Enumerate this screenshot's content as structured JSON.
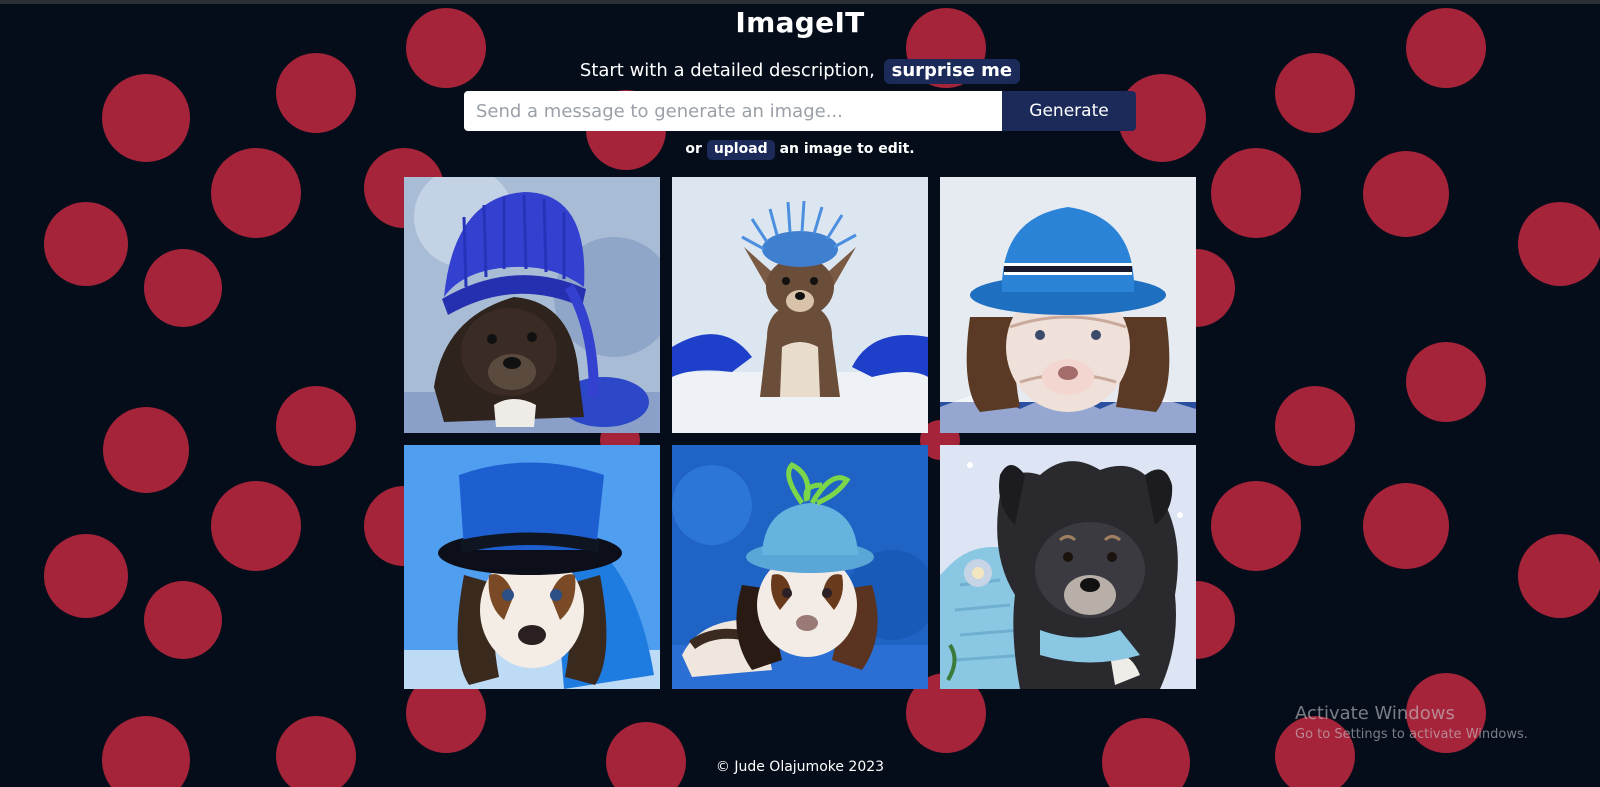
{
  "app": {
    "title": "ImageIT"
  },
  "hero": {
    "subtitle": "Start with a detailed description,",
    "surprise_label": "surprise me"
  },
  "prompt": {
    "placeholder": "Send a message to generate an image...",
    "value": "",
    "generate_label": "Generate"
  },
  "upload_line": {
    "prefix": "or",
    "upload_label": "upload",
    "suffix": "an image to edit."
  },
  "gallery": {
    "images": [
      {
        "subject": "boxer-puppy-knit-blue-hat"
      },
      {
        "subject": "chihuahua-puppy-fuzzy-blue-hat"
      },
      {
        "subject": "basset-puppy-blue-fedora"
      },
      {
        "subject": "beagle-puppy-blue-top-hat"
      },
      {
        "subject": "basset-puppy-teal-hat-ribbon"
      },
      {
        "subject": "fluffy-puppy-knit-sweater"
      }
    ]
  },
  "footer": {
    "text": "© Jude Olajumoke 2023"
  },
  "os_watermark": {
    "title": "Activate Windows",
    "subtitle": "Go to Settings to activate Windows."
  },
  "colors": {
    "background": "#050d1a",
    "dots": "#a5243a",
    "accent": "#1c2a5a"
  }
}
